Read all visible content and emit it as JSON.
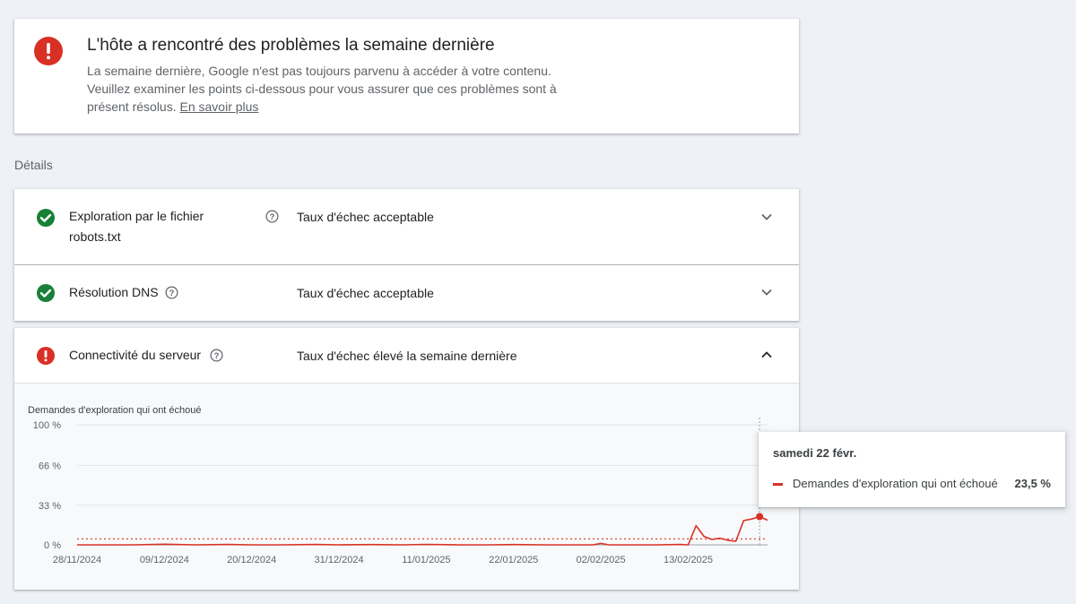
{
  "alert": {
    "title": "L'hôte a rencontré des problèmes la semaine dernière",
    "text": "La semaine dernière, Google n'est pas toujours parvenu à accéder à votre contenu. Veuillez examiner les points ci-dessous pour vous assurer que ces problèmes sont à présent résolus.",
    "link": "En savoir plus",
    "icon": "error-icon"
  },
  "details_label": "Détails",
  "rows": [
    {
      "name_line1": "Exploration par le fichier",
      "name_line2": "robots.txt",
      "status": "Taux d'échec acceptable",
      "icon": "check-circle-icon",
      "expanded": false
    },
    {
      "name": "Résolution DNS",
      "status": "Taux d'échec acceptable",
      "icon": "check-circle-icon",
      "expanded": false
    },
    {
      "name": "Connectivité du serveur",
      "status": "Taux d'échec élevé la semaine dernière",
      "icon": "error-icon",
      "expanded": true
    }
  ],
  "colors": {
    "error": "#d93025",
    "success": "#188038",
    "line": "#d93025",
    "threshold": "#d93025"
  },
  "chart_data": {
    "type": "line",
    "title": "Demandes d'exploration qui ont échoué",
    "y_ticks": [
      "100 %",
      "66 %",
      "33 %",
      "0 %"
    ],
    "ylim": [
      0,
      100
    ],
    "x_ticks": [
      "28/11/2024",
      "09/12/2024",
      "20/12/2024",
      "31/12/2024",
      "11/01/2025",
      "22/01/2025",
      "02/02/2025",
      "13/02/2025"
    ],
    "x": [
      "2024-11-28",
      "2024-12-01",
      "2024-12-05",
      "2024-12-09",
      "2024-12-13",
      "2024-12-17",
      "2024-12-20",
      "2024-12-24",
      "2024-12-28",
      "2024-12-31",
      "2025-01-04",
      "2025-01-08",
      "2025-01-11",
      "2025-01-15",
      "2025-01-19",
      "2025-01-22",
      "2025-01-26",
      "2025-01-30",
      "2025-02-01",
      "2025-02-02",
      "2025-02-03",
      "2025-02-06",
      "2025-02-09",
      "2025-02-12",
      "2025-02-13",
      "2025-02-14",
      "2025-02-15",
      "2025-02-16",
      "2025-02-17",
      "2025-02-18",
      "2025-02-19",
      "2025-02-20",
      "2025-02-21",
      "2025-02-22",
      "2025-02-23"
    ],
    "series": [
      {
        "name": "Demandes d'exploration qui ont échoué",
        "values": [
          0,
          0,
          0,
          0.5,
          0,
          0.3,
          0,
          0,
          0.3,
          0,
          0.2,
          0,
          0.4,
          0,
          0,
          0.2,
          0,
          0,
          0,
          1.2,
          0,
          0,
          0,
          0.3,
          0,
          16,
          7,
          4.5,
          5.5,
          3.8,
          3,
          20.2,
          21.5,
          23.5,
          20.5
        ]
      }
    ],
    "threshold": 5,
    "grid": true,
    "tooltip": {
      "date": "samedi 22 févr.",
      "series": "Demandes d'exploration qui ont échoué",
      "value": "23,5 %"
    },
    "highlight_index": 33
  }
}
